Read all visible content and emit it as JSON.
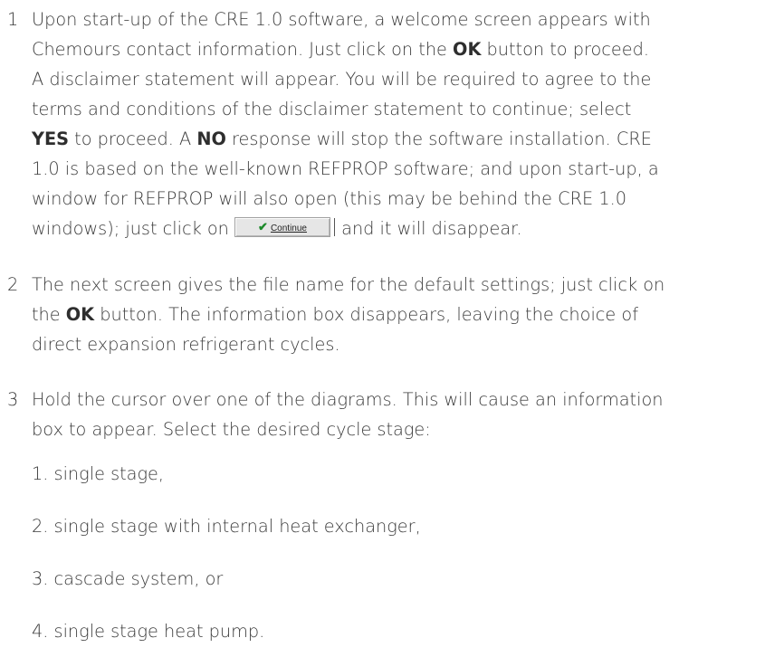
{
  "steps": [
    {
      "number": "1",
      "lines": [
        [
          {
            "t": "Upon start-up of the CRE 1.0 software, a welcome screen appears with"
          }
        ],
        [
          {
            "t": "Chemours contact information. Just click on the "
          },
          {
            "b": "OK"
          },
          {
            "t": " button to proceed."
          }
        ],
        [
          {
            "t": "A disclaimer statement will appear. You will be required to agree to the"
          }
        ],
        [
          {
            "t": "terms and conditions of the disclaimer statement to continue; select"
          }
        ],
        [
          {
            "b": "YES"
          },
          {
            "t": " to proceed. A "
          },
          {
            "b": "NO"
          },
          {
            "t": " response will stop the software installation. CRE"
          }
        ],
        [
          {
            "t": "1.0 is based on the well-known REFPROP software; and upon start-up, a"
          }
        ],
        [
          {
            "t": "window for REFPROP will also open (this may be behind the CRE 1.0"
          }
        ],
        [
          {
            "t": "windows); just click on "
          },
          {
            "btn": "continue"
          },
          {
            "t": " and it will disappear."
          }
        ]
      ]
    },
    {
      "number": "2",
      "lines": [
        [
          {
            "t": "The next screen gives the file name for the default settings; just click on"
          }
        ],
        [
          {
            "t": "the "
          },
          {
            "b": "OK"
          },
          {
            "t": " button. The information box disappears, leaving the choice of"
          }
        ],
        [
          {
            "t": "direct expansion refrigerant cycles."
          }
        ]
      ]
    },
    {
      "number": "3",
      "lines": [
        [
          {
            "t": "Hold the cursor over one of the diagrams. This will cause an information"
          }
        ],
        [
          {
            "t": "box to appear. Select the desired cycle stage:"
          }
        ]
      ]
    }
  ],
  "continue_button": {
    "label": "Continue",
    "icon": "checkmark-icon",
    "icon_color": "#1c8a2a"
  },
  "cycle_options": [
    "1. single stage,",
    "2. single stage with internal heat exchanger,",
    "3. cascade system, or",
    "4. single stage heat pump."
  ],
  "colors": {
    "text": "#3a3a3a",
    "bold_text": "#2e2e2e"
  }
}
